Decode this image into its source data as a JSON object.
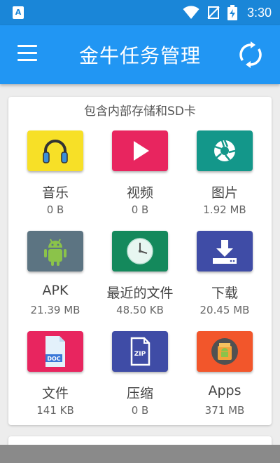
{
  "status_bar": {
    "notification_badge": "A",
    "time": "3:30"
  },
  "app_bar": {
    "title": "金牛任务管理",
    "menu_icon": "hamburger-menu-icon",
    "refresh_icon": "refresh-icon"
  },
  "storage_card": {
    "title": "包含内部存储和SD卡",
    "categories": [
      {
        "label": "音乐",
        "size": "0 B",
        "icon": "headphones-icon",
        "color": "#f7e027"
      },
      {
        "label": "视频",
        "size": "0 B",
        "icon": "play-icon",
        "color": "#e8255f"
      },
      {
        "label": "图片",
        "size": "1.92 MB",
        "icon": "camera-aperture-icon",
        "color": "#13978a"
      },
      {
        "label": "APK",
        "size": "21.39 MB",
        "icon": "android-icon",
        "color": "#5c7482"
      },
      {
        "label": "最近的文件",
        "size": "48.50 KB",
        "icon": "clock-icon",
        "color": "#14895c"
      },
      {
        "label": "下载",
        "size": "20.45 MB",
        "icon": "download-icon",
        "color": "#3f4ca6"
      },
      {
        "label": "文件",
        "size": "141 KB",
        "icon": "doc-file-icon",
        "color": "#e8255f"
      },
      {
        "label": "压缩",
        "size": "0 B",
        "icon": "zip-file-icon",
        "color": "#3f4ca6"
      },
      {
        "label": "Apps",
        "size": "371 MB",
        "icon": "apps-package-icon",
        "color": "#f2562b"
      }
    ]
  }
}
